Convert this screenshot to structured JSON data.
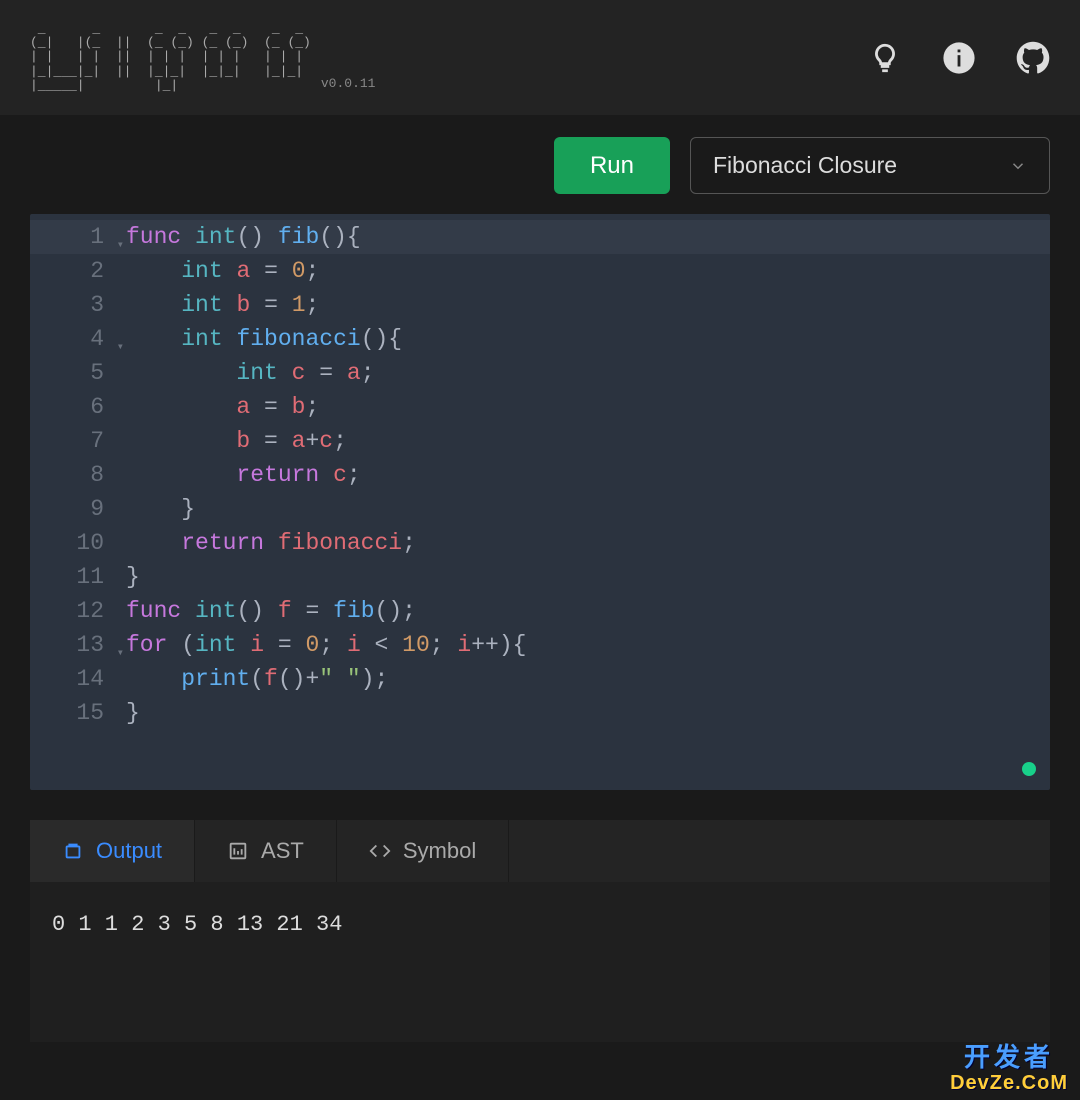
{
  "header": {
    "ascii_logo": " _      _       _  _   _  _    _  _\n(_|   |(_  ||  (_ (_) (_ (_)  (_ (_)\n| |   | |  ||  | | |  | | |   | | |\n|_|___|_|  ||  |_|_|  |_|_|   |_|_|\n|_____|         |_|",
    "version": "v0.0.11"
  },
  "toolbar": {
    "run_label": "Run",
    "select_value": "Fibonacci Closure"
  },
  "code_lines": [
    {
      "n": 1,
      "fold": true,
      "hl": true,
      "tokens": [
        [
          "kw-func",
          "func"
        ],
        [
          "op",
          " "
        ],
        [
          "kw-type",
          "int"
        ],
        [
          "punct",
          "()"
        ],
        [
          "op",
          " "
        ],
        [
          "fn-name",
          "fib"
        ],
        [
          "punct",
          "(){"
        ]
      ]
    },
    {
      "n": 2,
      "fold": false,
      "hl": false,
      "tokens": [
        [
          "op",
          "    "
        ],
        [
          "kw-type",
          "int"
        ],
        [
          "op",
          " "
        ],
        [
          "ident",
          "a"
        ],
        [
          "op",
          " = "
        ],
        [
          "num",
          "0"
        ],
        [
          "punct",
          ";"
        ]
      ]
    },
    {
      "n": 3,
      "fold": false,
      "hl": false,
      "tokens": [
        [
          "op",
          "    "
        ],
        [
          "kw-type",
          "int"
        ],
        [
          "op",
          " "
        ],
        [
          "ident",
          "b"
        ],
        [
          "op",
          " = "
        ],
        [
          "num",
          "1"
        ],
        [
          "punct",
          ";"
        ]
      ]
    },
    {
      "n": 4,
      "fold": true,
      "hl": false,
      "tokens": [
        [
          "op",
          "    "
        ],
        [
          "kw-type",
          "int"
        ],
        [
          "op",
          " "
        ],
        [
          "fn-name",
          "fibonacci"
        ],
        [
          "punct",
          "(){"
        ]
      ]
    },
    {
      "n": 5,
      "fold": false,
      "hl": false,
      "tokens": [
        [
          "op",
          "        "
        ],
        [
          "kw-type",
          "int"
        ],
        [
          "op",
          " "
        ],
        [
          "ident",
          "c"
        ],
        [
          "op",
          " = "
        ],
        [
          "ident",
          "a"
        ],
        [
          "punct",
          ";"
        ]
      ]
    },
    {
      "n": 6,
      "fold": false,
      "hl": false,
      "tokens": [
        [
          "op",
          "        "
        ],
        [
          "ident",
          "a"
        ],
        [
          "op",
          " = "
        ],
        [
          "ident",
          "b"
        ],
        [
          "punct",
          ";"
        ]
      ]
    },
    {
      "n": 7,
      "fold": false,
      "hl": false,
      "tokens": [
        [
          "op",
          "        "
        ],
        [
          "ident",
          "b"
        ],
        [
          "op",
          " = "
        ],
        [
          "ident",
          "a"
        ],
        [
          "op",
          "+"
        ],
        [
          "ident",
          "c"
        ],
        [
          "punct",
          ";"
        ]
      ]
    },
    {
      "n": 8,
      "fold": false,
      "hl": false,
      "tokens": [
        [
          "op",
          "        "
        ],
        [
          "kw-ctrl",
          "return"
        ],
        [
          "op",
          " "
        ],
        [
          "ident",
          "c"
        ],
        [
          "punct",
          ";"
        ]
      ]
    },
    {
      "n": 9,
      "fold": false,
      "hl": false,
      "tokens": [
        [
          "op",
          "    "
        ],
        [
          "punct",
          "}"
        ]
      ]
    },
    {
      "n": 10,
      "fold": false,
      "hl": false,
      "tokens": [
        [
          "op",
          "    "
        ],
        [
          "kw-ctrl",
          "return"
        ],
        [
          "op",
          " "
        ],
        [
          "ident",
          "fibonacci"
        ],
        [
          "punct",
          ";"
        ]
      ]
    },
    {
      "n": 11,
      "fold": false,
      "hl": false,
      "tokens": [
        [
          "punct",
          "}"
        ]
      ]
    },
    {
      "n": 12,
      "fold": false,
      "hl": false,
      "tokens": [
        [
          "kw-func",
          "func"
        ],
        [
          "op",
          " "
        ],
        [
          "kw-type",
          "int"
        ],
        [
          "punct",
          "()"
        ],
        [
          "op",
          " "
        ],
        [
          "ident",
          "f"
        ],
        [
          "op",
          " = "
        ],
        [
          "fn-name",
          "fib"
        ],
        [
          "punct",
          "();"
        ]
      ]
    },
    {
      "n": 13,
      "fold": true,
      "hl": false,
      "tokens": [
        [
          "kw-ctrl",
          "for"
        ],
        [
          "op",
          " "
        ],
        [
          "punct",
          "("
        ],
        [
          "kw-type",
          "int"
        ],
        [
          "op",
          " "
        ],
        [
          "ident",
          "i"
        ],
        [
          "op",
          " = "
        ],
        [
          "num",
          "0"
        ],
        [
          "punct",
          "; "
        ],
        [
          "ident",
          "i"
        ],
        [
          "op",
          " < "
        ],
        [
          "num",
          "10"
        ],
        [
          "punct",
          "; "
        ],
        [
          "ident",
          "i"
        ],
        [
          "op",
          "++"
        ],
        [
          "punct",
          "){"
        ]
      ]
    },
    {
      "n": 14,
      "fold": false,
      "hl": false,
      "tokens": [
        [
          "op",
          "    "
        ],
        [
          "fn-name",
          "print"
        ],
        [
          "punct",
          "("
        ],
        [
          "ident",
          "f"
        ],
        [
          "punct",
          "()"
        ],
        [
          "op",
          "+"
        ],
        [
          "str",
          "\" \""
        ],
        [
          "punct",
          ");"
        ]
      ]
    },
    {
      "n": 15,
      "fold": false,
      "hl": false,
      "tokens": [
        [
          "punct",
          "}"
        ]
      ]
    }
  ],
  "tabs": [
    {
      "key": "output",
      "label": "Output",
      "active": true
    },
    {
      "key": "ast",
      "label": "AST",
      "active": false
    },
    {
      "key": "symbol",
      "label": "Symbol",
      "active": false
    }
  ],
  "output_text": "0 1 1 2 3 5 8 13 21 34 ",
  "watermark": {
    "top": "开发者",
    "bot": "DevZe.CoM"
  }
}
